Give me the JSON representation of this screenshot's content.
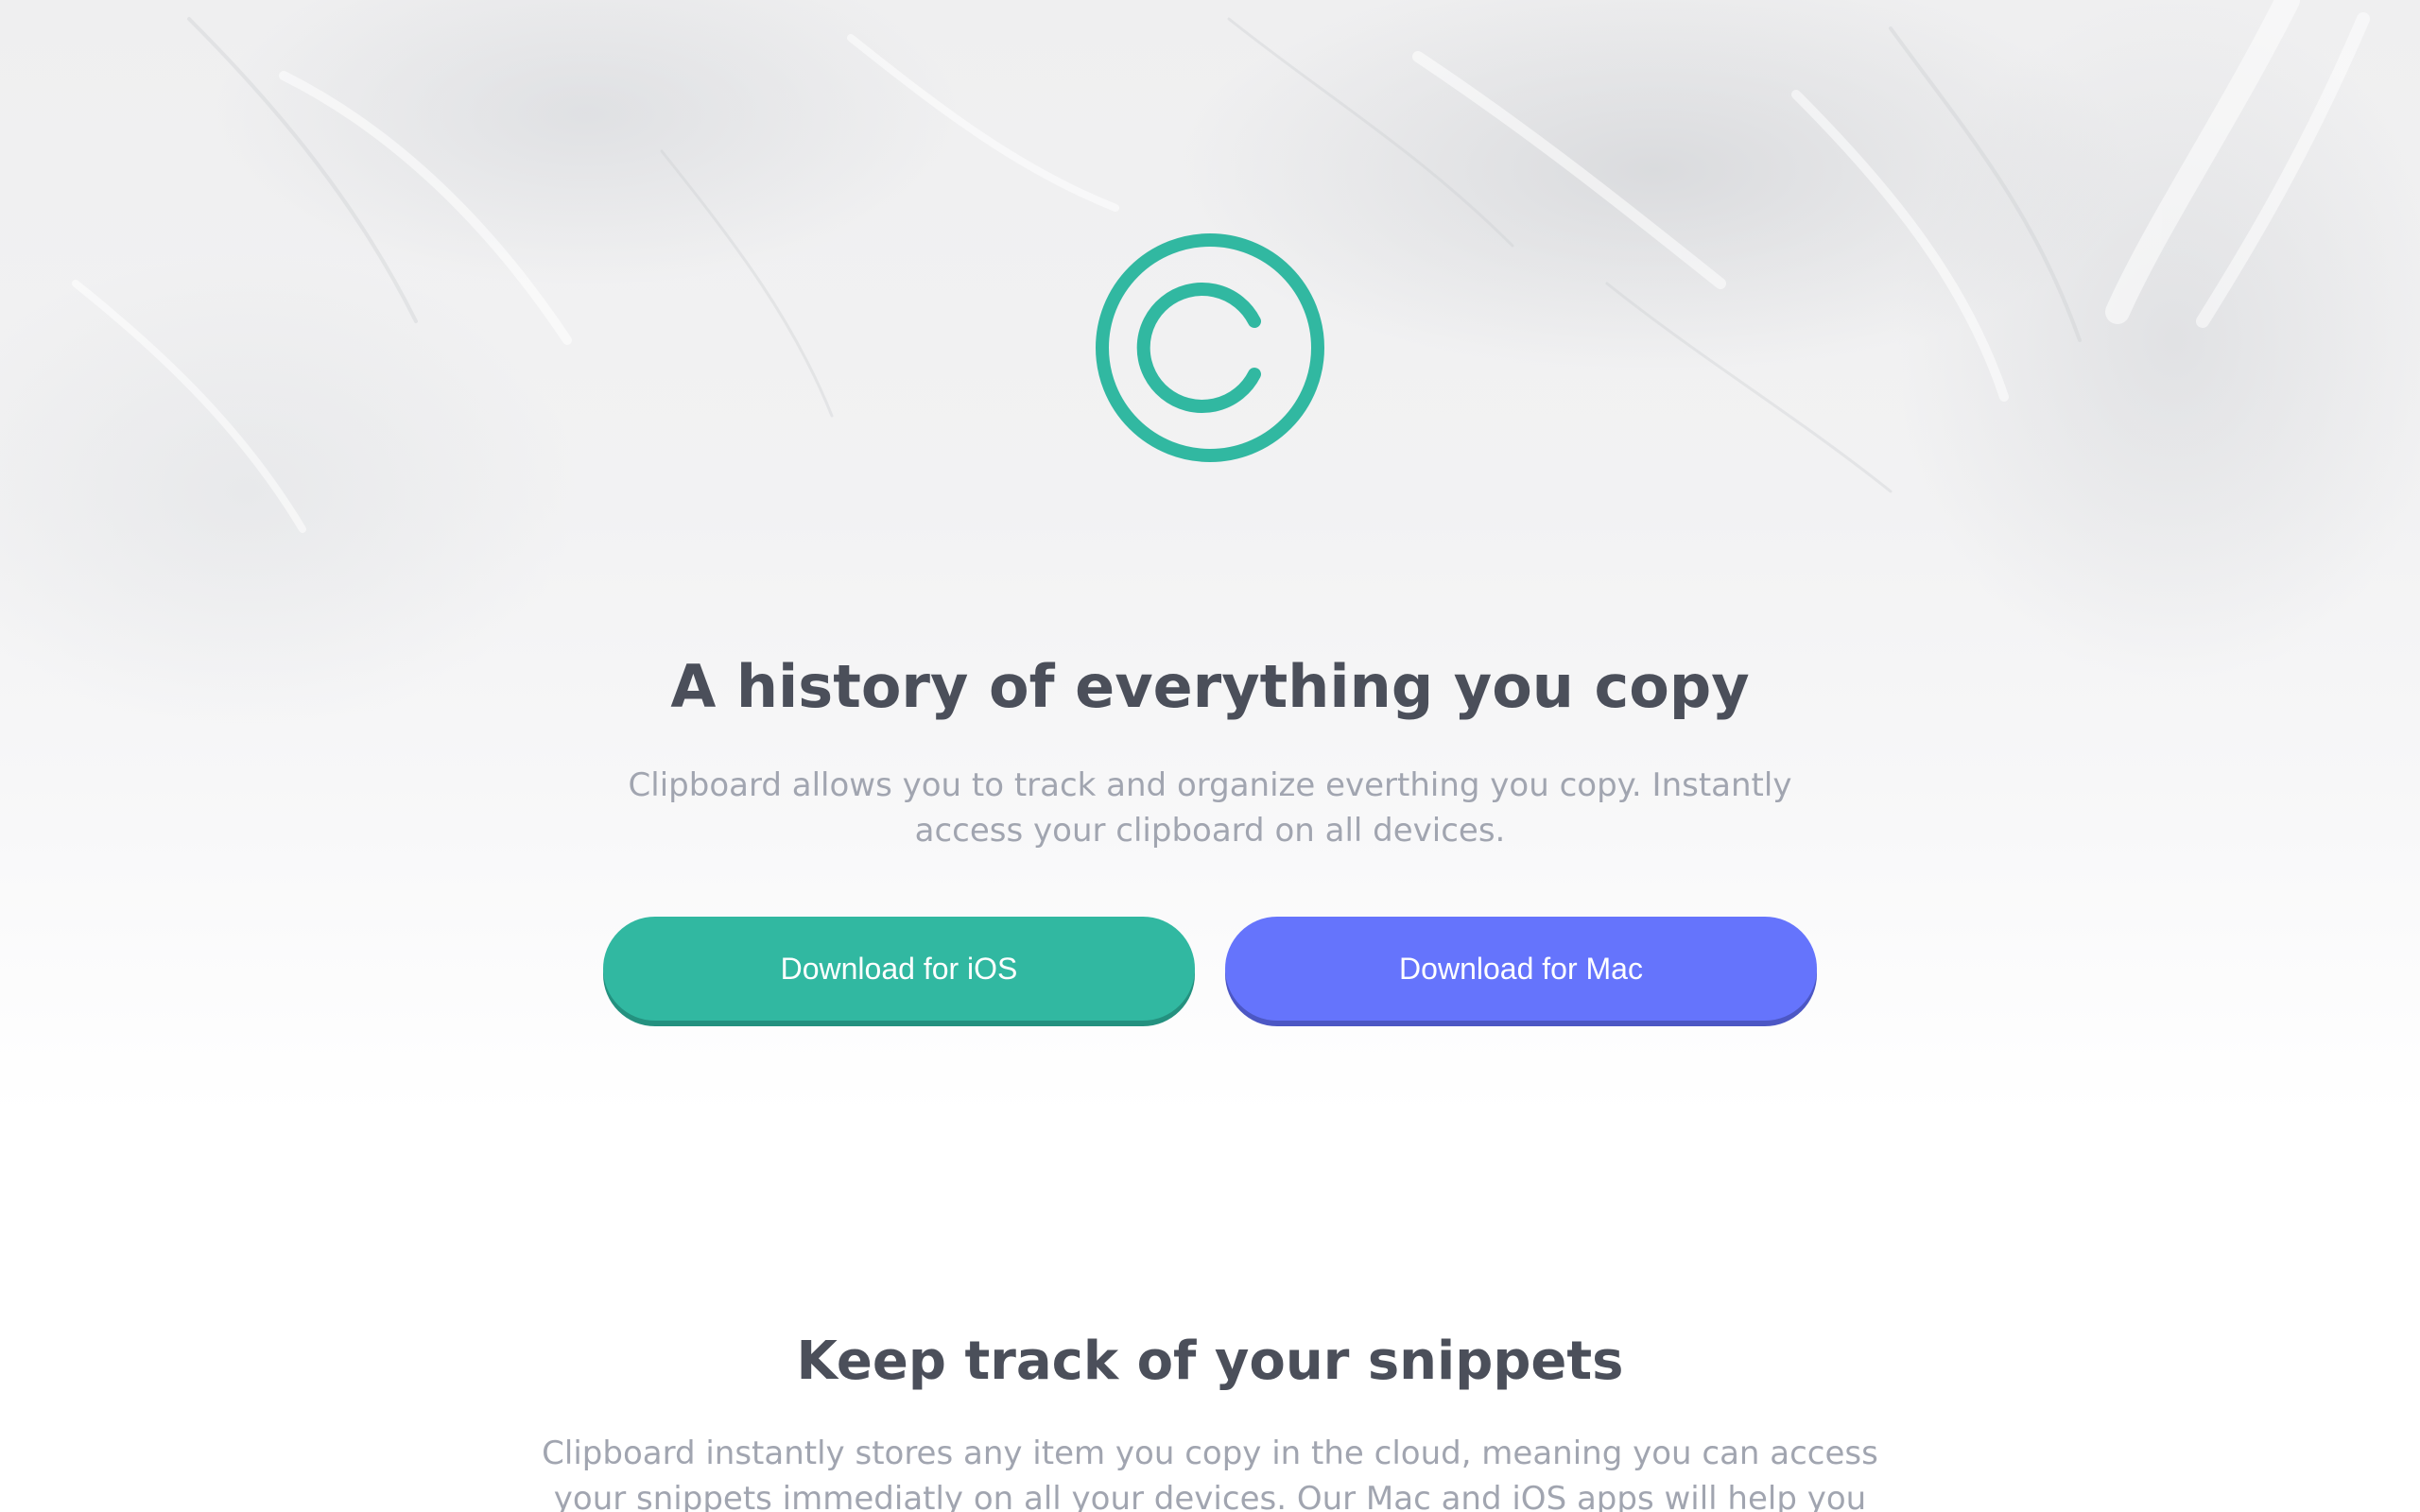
{
  "colors": {
    "primary_green": "#31b8a1",
    "secondary_blue": "#6574fc",
    "heading": "#4b4f5a",
    "body_text": "#a1a5b0"
  },
  "hero": {
    "logo_icon": "copyright-icon",
    "title": "A history of everything you copy",
    "description": "Clipboard allows you to track and organize everthing you copy. Instantly access your clipboard on all devices.",
    "buttons": {
      "ios_label": "Download for iOS",
      "mac_label": "Download for Mac"
    }
  },
  "snippets_section": {
    "title": "Keep track of your snippets",
    "description": "Clipboard instantly stores any item you copy in the cloud, meaning you can access your snippets immediatly on all your devices. Our Mac and iOS apps will help you organize everything."
  }
}
